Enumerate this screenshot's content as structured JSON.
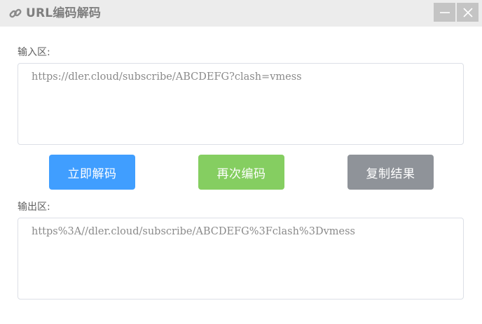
{
  "window": {
    "title": "URL编码解码",
    "icon": "link-icon",
    "controls": {
      "minimize_icon": "minimize-icon",
      "close_icon": "close-icon"
    }
  },
  "input": {
    "label": "输入区:",
    "value": "https://dler.cloud/subscribe/ABCDEFG?clash=vmess"
  },
  "actions": {
    "decode_label": "立即解码",
    "encode_label": "再次编码",
    "copy_label": "复制结果"
  },
  "output": {
    "label": "输出区:",
    "value": "https%3A//dler.cloud/subscribe/ABCDEFG%3Fclash%3Dvmess"
  },
  "colors": {
    "decode": "#409eff",
    "encode": "#85ce61",
    "copy": "#8f9399",
    "titlebar": "#ececec"
  }
}
